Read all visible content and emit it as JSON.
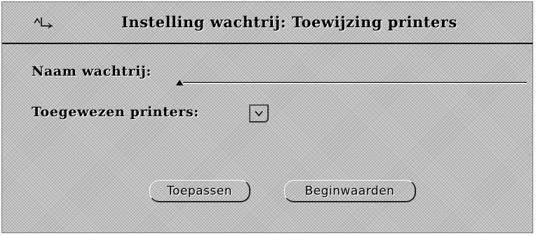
{
  "window": {
    "title": "Instelling wachtrij: Toewijzing printers",
    "menu_icon": "window-menu-icon"
  },
  "form": {
    "queue_name_label": "Naam wachtrij:",
    "queue_name_value": "",
    "assigned_printers_label": "Toegewezen printers:",
    "assigned_printers_menu_icon": "menu-button-icon"
  },
  "buttons": {
    "apply_label": "Toepassen",
    "reset_label": "Beginwaarden"
  }
}
